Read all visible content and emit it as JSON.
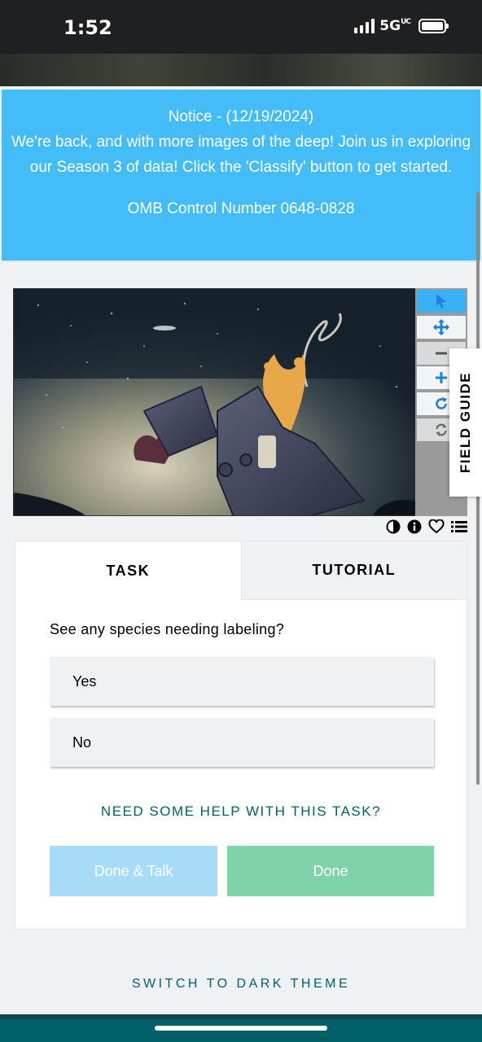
{
  "status_bar": {
    "time": "1:52",
    "network": "5G",
    "network_suffix": "UC"
  },
  "notice": {
    "line1": "Notice - (12/19/2024)",
    "line2": "We're back, and with more images of the deep! Join us in exploring our Season 3 of data! Click the 'Classify' button to get started.",
    "omb": "OMB Control Number 0648-0828"
  },
  "viewer": {
    "image_icon": "seafloor-photo",
    "tools": [
      {
        "name": "pointer",
        "icon": "cursor-arrow-icon"
      },
      {
        "name": "pan",
        "icon": "move-arrows-icon"
      },
      {
        "name": "zoom-out",
        "icon": "minus-icon"
      },
      {
        "name": "zoom-in",
        "icon": "plus-icon"
      },
      {
        "name": "rotate",
        "icon": "rotate-icon"
      },
      {
        "name": "reset",
        "icon": "refresh-icon"
      }
    ],
    "field_guide_label": "FIELD GUIDE",
    "meta_icons": [
      "contrast-icon",
      "info-icon",
      "heart-icon",
      "list-icon"
    ]
  },
  "colors": {
    "notice_bg": "#43bcf8",
    "tool_active": "#3ab0f5",
    "accent_blue": "#1f7fe0",
    "teal_text": "#00606a",
    "done_green": "#7ed3a8",
    "talk_blue": "#a6dcfa"
  },
  "task_panel": {
    "tabs": [
      "TASK",
      "TUTORIAL"
    ],
    "question": "See any species needing labeling?",
    "answers": [
      "Yes",
      "No"
    ],
    "help_link": "NEED SOME HELP WITH THIS TASK?",
    "done_talk": "Done & Talk",
    "done": "Done"
  },
  "footer": {
    "dark_theme_link": "SWITCH TO DARK THEME"
  }
}
